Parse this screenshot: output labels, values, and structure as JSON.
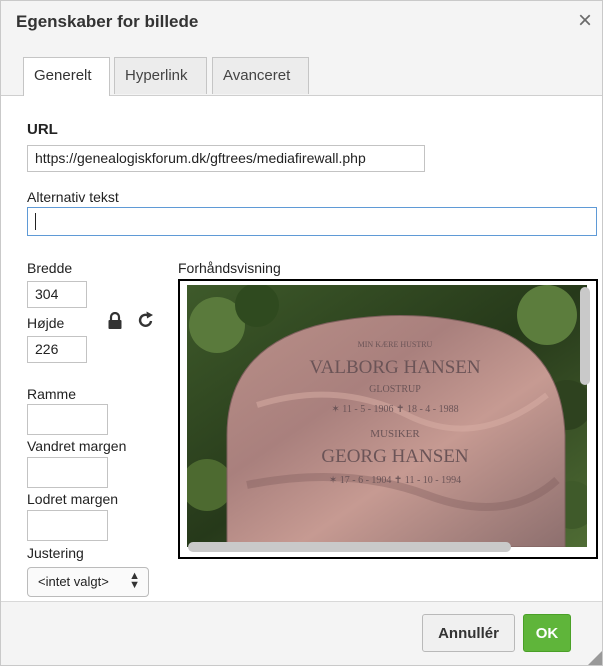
{
  "dialog": {
    "title": "Egenskaber for billede",
    "close_glyph": "×"
  },
  "tabs": [
    {
      "label": "Generelt",
      "active": true
    },
    {
      "label": "Hyperlink",
      "active": false
    },
    {
      "label": "Avanceret",
      "active": false
    }
  ],
  "form": {
    "url_label": "URL",
    "url_value": "https://genealogiskforum.dk/gftrees/mediafirewall.php",
    "alt_label": "Alternativ tekst",
    "alt_value": "",
    "width_label": "Bredde",
    "width_value": "304",
    "height_label": "Højde",
    "height_value": "226",
    "border_label": "Ramme",
    "border_value": "",
    "hspace_label": "Vandret margen",
    "hspace_value": "",
    "vspace_label": "Lodret margen",
    "vspace_value": "",
    "align_label": "Justering",
    "align_value": "<intet valgt>",
    "preview_label": "Forhåndsvisning"
  },
  "preview_image": {
    "inscription": [
      "MIN KÆRE HUSTRU",
      "VALBORG HANSEN",
      "GLOSTRUP",
      "✶ 11 - 5 - 1906 ✝ 18 - 4 - 1988",
      "MUSIKER",
      "GEORG HANSEN",
      "✶ 17 - 6 - 1904 ✝ 11 - 10 - 1994"
    ]
  },
  "icons": {
    "lock": "lock-icon",
    "refresh": "refresh-icon",
    "close": "close-icon",
    "select_arrows": "▲▼"
  },
  "footer": {
    "cancel_label": "Annullér",
    "ok_label": "OK"
  },
  "colors": {
    "ok_button": "#5fb53a",
    "focus_border": "#5f9ad6",
    "chrome": "#f4f4f4"
  }
}
